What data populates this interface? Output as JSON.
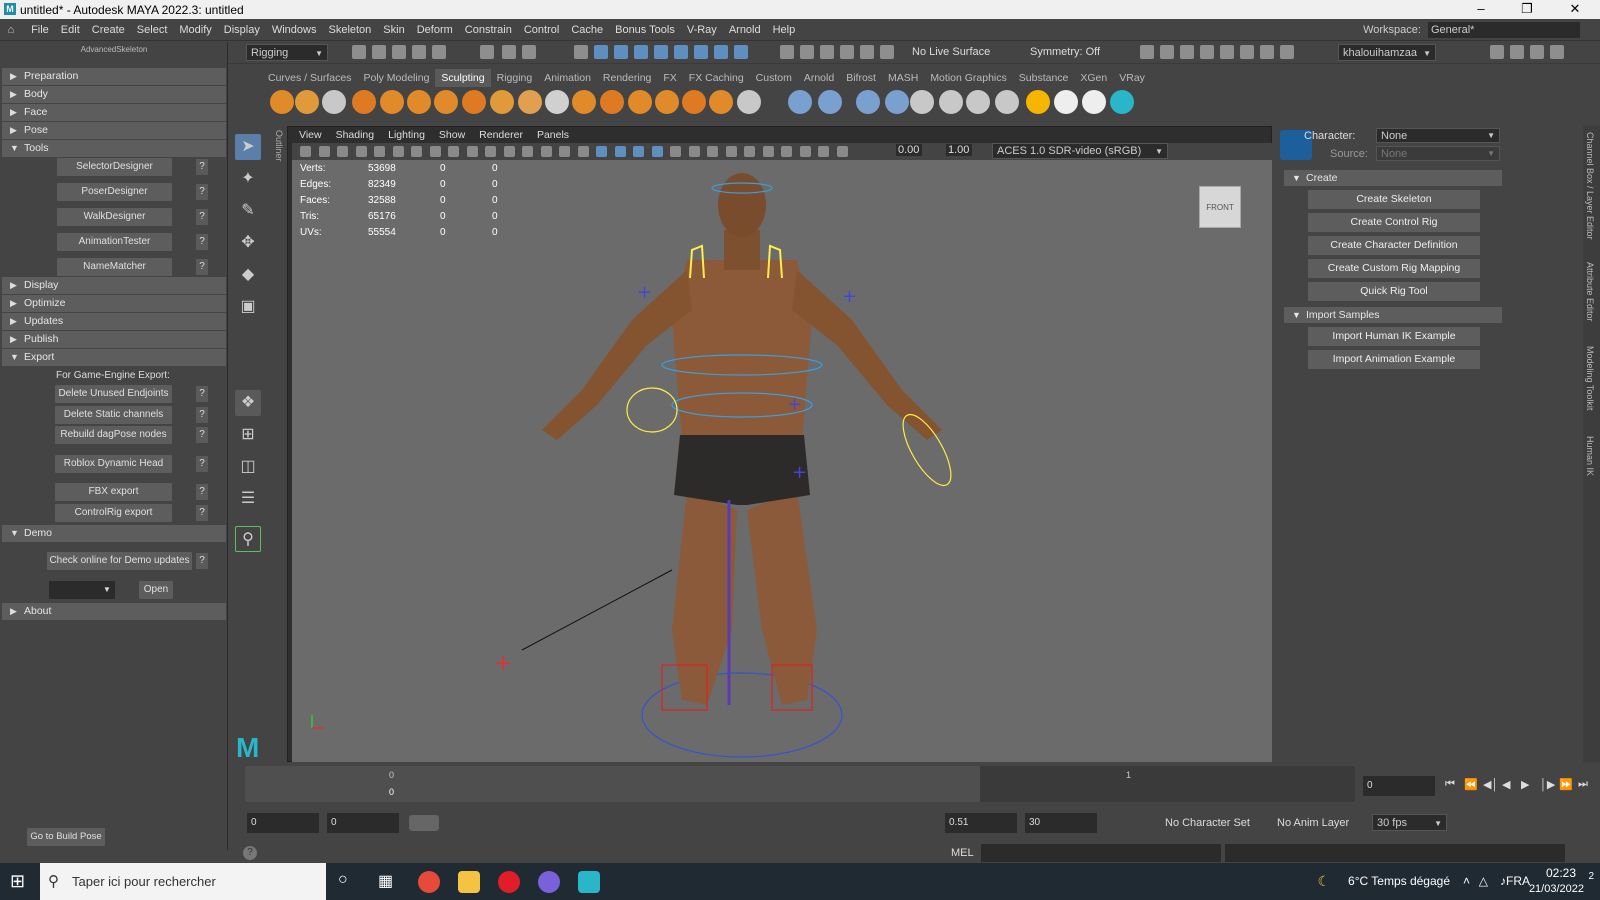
{
  "window": {
    "title": "untitled* - Autodesk MAYA 2022.3: untitled",
    "logo": "M"
  },
  "menu": {
    "items": [
      "File",
      "Edit",
      "Create",
      "Select",
      "Modify",
      "Display",
      "Windows",
      "Skeleton",
      "Skin",
      "Deform",
      "Constrain",
      "Control",
      "Cache",
      "Bonus Tools",
      "V-Ray",
      "Arnold",
      "Help"
    ],
    "workspace_label": "Workspace:",
    "workspace_value": "General*"
  },
  "status": {
    "menuset": "Rigging",
    "live_surface": "No Live Surface",
    "symmetry": "Symmetry: Off",
    "user": "khalouihamzaa"
  },
  "shelf": {
    "tabs": [
      "Curves / Surfaces",
      "Poly Modeling",
      "Sculpting",
      "Rigging",
      "Animation",
      "Rendering",
      "FX",
      "FX Caching",
      "Custom",
      "Arnold",
      "Bifrost",
      "MASH",
      "Motion Graphics",
      "Substance",
      "XGen",
      "VRay"
    ],
    "active": "Sculpting"
  },
  "left": {
    "title": "AdvancedSkeleton",
    "sections_top": [
      "Preparation",
      "Body",
      "Face",
      "Pose",
      "Tools"
    ],
    "tools_buttons": [
      "SelectorDesigner",
      "PoserDesigner",
      "WalkDesigner",
      "AnimationTester",
      "NameMatcher"
    ],
    "sections_mid": [
      "Display",
      "Optimize",
      "Updates",
      "Publish",
      "Export"
    ],
    "export_label": "For Game-Engine Export:",
    "export_buttons": [
      "Delete Unused Endjoints",
      "Delete Static channels",
      "Rebuild dagPose nodes",
      "Roblox Dynamic Head",
      "FBX export",
      "ControlRig export"
    ],
    "demo_section": "Demo",
    "demo_button": "Check online for Demo updates",
    "open_button": "Open",
    "about_section": "About",
    "help_glyph": "?",
    "build_pose": "Go to Build Pose"
  },
  "viewport": {
    "menus": [
      "View",
      "Shading",
      "Lighting",
      "Show",
      "Renderer",
      "Panels"
    ],
    "exposure": "0.00",
    "gamma": "1.00",
    "colorspace": "ACES 1.0 SDR-video (sRGB)",
    "hud": [
      {
        "k": "Verts:",
        "v": "53698",
        "a": "0",
        "b": "0"
      },
      {
        "k": "Edges:",
        "v": "82349",
        "a": "0",
        "b": "0"
      },
      {
        "k": "Faces:",
        "v": "32588",
        "a": "0",
        "b": "0"
      },
      {
        "k": "Tris:",
        "v": "65176",
        "a": "0",
        "b": "0"
      },
      {
        "k": "UVs:",
        "v": "55554",
        "a": "0",
        "b": "0"
      }
    ],
    "viewcube": "FRONT",
    "outliner_tab": "Outliner"
  },
  "hik": {
    "character_label": "Character:",
    "character_value": "None",
    "source_label": "Source:",
    "source_value": "None",
    "create_section": "Create",
    "create_buttons": [
      "Create Skeleton",
      "Create Control Rig",
      "Create Character Definition",
      "Create Custom Rig Mapping",
      "Quick Rig Tool"
    ],
    "import_section": "Import Samples",
    "import_buttons": [
      "Import Human IK Example",
      "Import Animation Example"
    ]
  },
  "sidetabs": [
    "Channel Box / Layer Editor",
    "Attribute Editor",
    "Modeling Toolkit",
    "Human IK"
  ],
  "time": {
    "frame_top": "0",
    "frame_mark": "1",
    "current": "0",
    "start": "0",
    "range_start": "0",
    "range_end": "0.51",
    "end": "30",
    "char_set": "No Character Set",
    "anim_layer": "No Anim Layer",
    "fps": "30 fps"
  },
  "cmd": {
    "label": "MEL",
    "help": "?"
  },
  "taskbar": {
    "search": "Taper ici pour rechercher",
    "weather": "6°C  Temps dégagé",
    "lang": "FRA",
    "time": "02:23",
    "date": "21/03/2022",
    "notifications": "2"
  },
  "colors": {
    "accent": "#5f8fbf",
    "maya_teal": "#29b6c8"
  }
}
